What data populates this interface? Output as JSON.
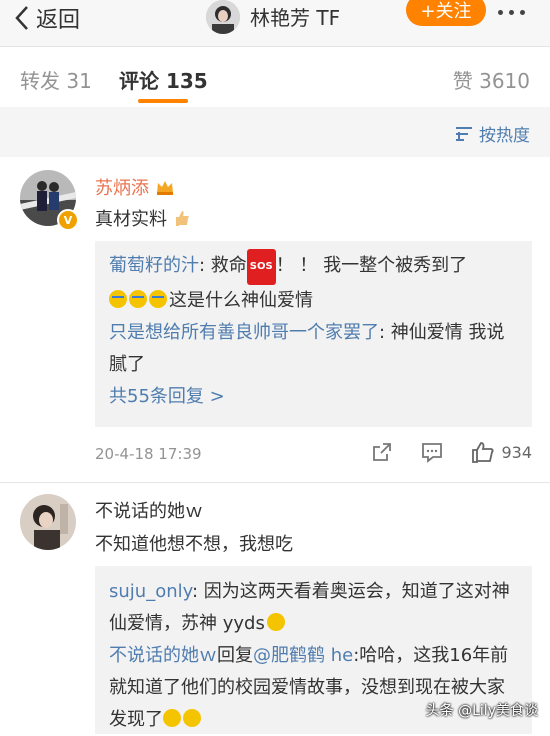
{
  "header": {
    "back_label": "返回",
    "name": "林艳芳 TF",
    "follow_label": "+关注"
  },
  "tabs": {
    "repost": "转发 31",
    "comment": "评论 135",
    "like": "赞 3610"
  },
  "sort": {
    "label": "按热度"
  },
  "comments": [
    {
      "username": "苏炳添",
      "text": "真材实料",
      "replies": [
        {
          "user": "葡萄籽的汁",
          "sep": ": ",
          "text_a": "救命",
          "badge": "SOS",
          "text_b": "！ ！ 我一整个被秀到了",
          "text_c": "这是什么神仙爱情"
        },
        {
          "user": "只是想给所有善良帅哥一个家罢了",
          "sep": ": ",
          "text": "神仙爱情 我说腻了"
        }
      ],
      "more_replies": "共55条回复 >",
      "time": "20-4-18 17:39",
      "likes": "934"
    },
    {
      "username": "不说话的她ｗ",
      "text": "不知道他想不想，我想吃",
      "replies": [
        {
          "user": "suju_only",
          "sep": ": ",
          "text": "因为这两天看着奥运会，知道了这对神仙爱情，苏神 yyds"
        },
        {
          "user": "不说话的她ｗ",
          "mid": "回复",
          "mention": "@肥鹤鹤 he",
          "text": ":哈哈，这我16年前就知道了他们的校园爱情故事，没想到现在被大家发现了"
        }
      ]
    }
  ],
  "watermark": "头条 @Lily美食谈",
  "colors": {
    "accent": "#ff8200",
    "link": "#507daf",
    "verified_name": "#eb7350"
  }
}
